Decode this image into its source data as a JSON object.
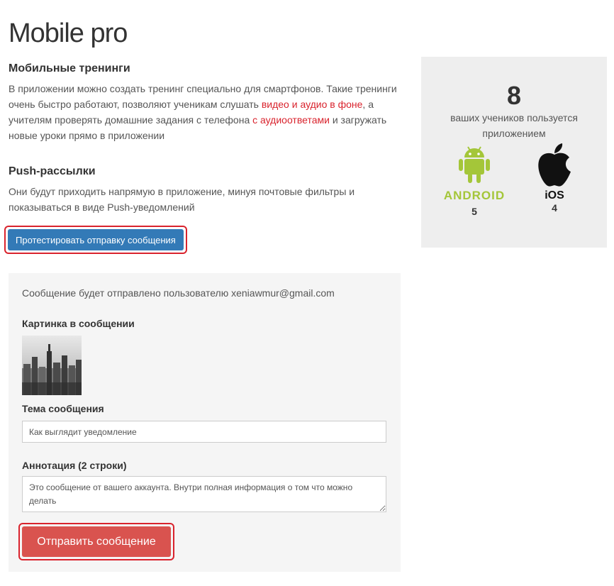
{
  "page": {
    "title": "Mobile pro"
  },
  "mobile_trainings": {
    "heading": "Мобильные тренинги",
    "text_part1": "В приложении можно создать тренинг специально для смартфонов. Такие тренинги очень быстро работают, позволяют ученикам слушать ",
    "link1": "видео и аудио в фоне",
    "text_part2": ", а учителям проверять домашние задания с телефона ",
    "link2": "с аудиоответами",
    "text_part3": " и загружать новые уроки прямо в приложении"
  },
  "push": {
    "heading": "Push-рассылки",
    "text": "Они будут приходить напрямую в приложение, минуя почтовые фильтры и показываться в виде Push-уведомлений",
    "test_button": "Протестировать отправку сообщения"
  },
  "form": {
    "intro": "Сообщение будет отправлено пользователю xeniawmur@gmail.com",
    "image_label": "Картинка в сообщении",
    "subject_label": "Тема сообщения",
    "subject_value": "Как выглядит уведомление",
    "annotation_label": "Аннотация (2 строки)",
    "annotation_value": "Это сообщение от вашего аккаунта. Внутри полная информация о том что можно делать",
    "send_button": "Отправить сообщение"
  },
  "stats": {
    "count": "8",
    "caption": "ваших учеников пользуется приложением",
    "android_label": "ANDROID",
    "android_count": "5",
    "ios_label": "iOS",
    "ios_count": "4"
  },
  "colors": {
    "link_red": "#d9232d",
    "blue_button": "#337ab7",
    "red_button": "#d9534f",
    "android_green": "#a4c639"
  },
  "icons": [
    "android-icon",
    "apple-icon"
  ]
}
